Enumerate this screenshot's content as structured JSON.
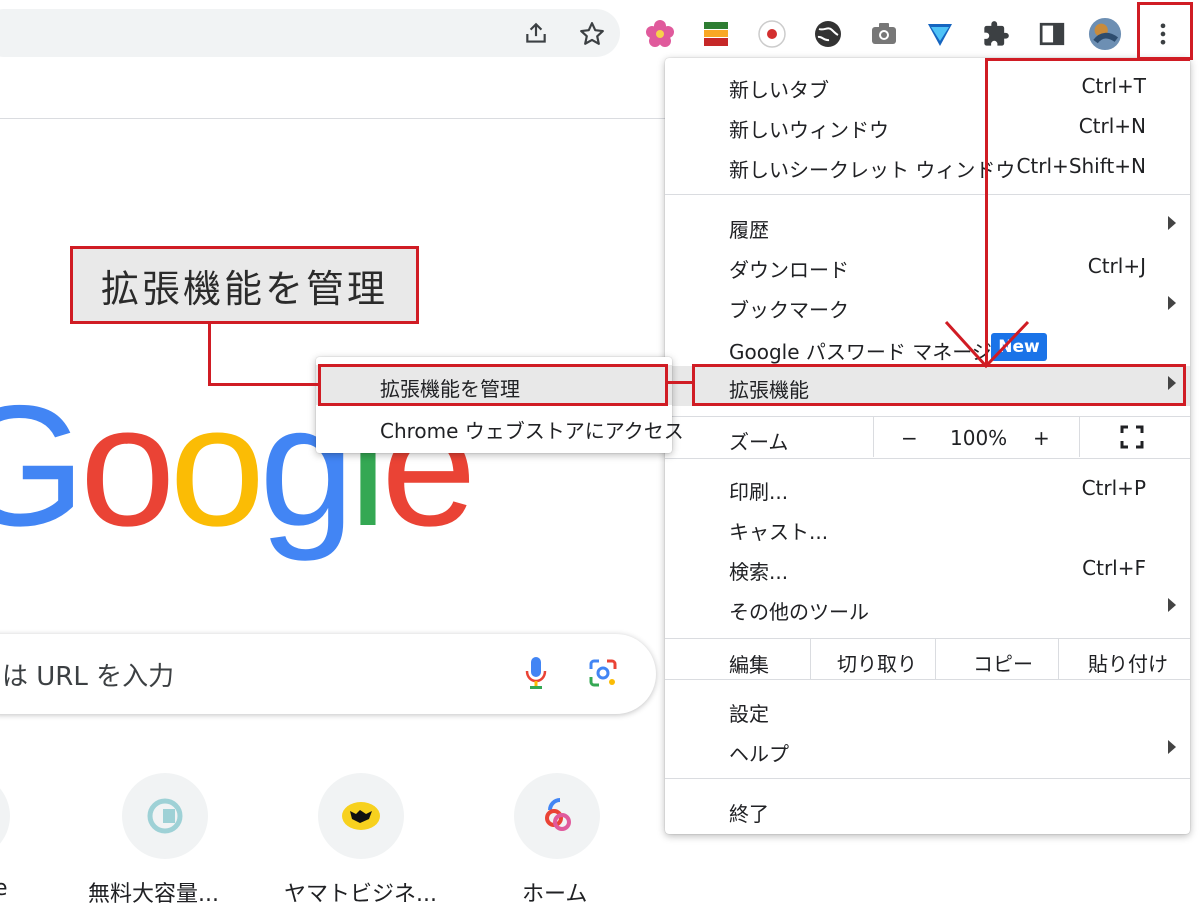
{
  "callout": {
    "label": "拡張機能を管理"
  },
  "search": {
    "placeholder_partial": "は URL を入力"
  },
  "shortcuts": [
    {
      "label": "e"
    },
    {
      "label": "無料大容量..."
    },
    {
      "label": "ヤマトビジネ..."
    },
    {
      "label": "ホーム"
    }
  ],
  "toolbar": {
    "icons": [
      "share-icon",
      "bookmark-star-icon",
      "flower-extension-icon",
      "stacked-layers-extension-icon",
      "red-dot-extension-icon",
      "globe-extension-icon",
      "camera-extension-icon",
      "heart-rate-extension-icon",
      "puzzle-extensions-icon",
      "side-panel-icon",
      "profile-avatar",
      "more-vertical-icon"
    ]
  },
  "menu": {
    "new_tab": {
      "label": "新しいタブ",
      "shortcut": "Ctrl+T"
    },
    "new_window": {
      "label": "新しいウィンドウ",
      "shortcut": "Ctrl+N"
    },
    "new_incognito": {
      "label": "新しいシークレット ウィンドウ",
      "shortcut": "Ctrl+Shift+N"
    },
    "history": {
      "label": "履歴"
    },
    "downloads": {
      "label": "ダウンロード",
      "shortcut": "Ctrl+J"
    },
    "bookmarks": {
      "label": "ブックマーク"
    },
    "password_manager": {
      "label": "Google パスワード マネージャー",
      "badge": "New"
    },
    "extensions": {
      "label": "拡張機能"
    },
    "zoom": {
      "label": "ズーム",
      "minus": "−",
      "value": "100%",
      "plus": "+"
    },
    "print": {
      "label": "印刷...",
      "shortcut": "Ctrl+P"
    },
    "cast": {
      "label": "キャスト..."
    },
    "find": {
      "label": "検索...",
      "shortcut": "Ctrl+F"
    },
    "more_tools": {
      "label": "その他のツール"
    },
    "edit": {
      "label": "編集",
      "cut": "切り取り",
      "copy": "コピー",
      "paste": "貼り付け"
    },
    "settings": {
      "label": "設定"
    },
    "help": {
      "label": "ヘルプ"
    },
    "exit": {
      "label": "終了"
    }
  },
  "submenu": {
    "manage": "拡張機能を管理",
    "webstore": "Chrome ウェブストアにアクセス"
  },
  "colors": {
    "annotation_red": "#d01c24",
    "badge_blue": "#1a73e8",
    "highlight": "#e8e8e8"
  }
}
